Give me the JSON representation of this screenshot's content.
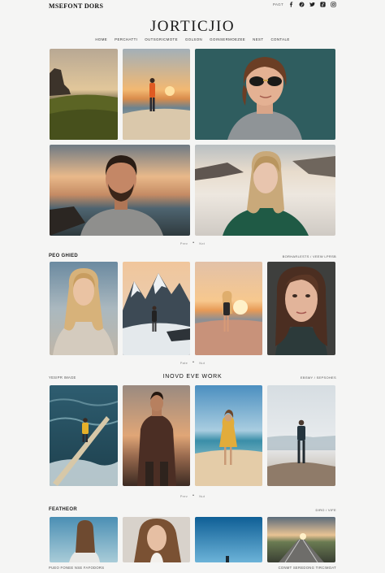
{
  "header": {
    "brand": "MSEFONT DORS",
    "top_link": "PAGT",
    "social_icons": [
      "facebook-icon",
      "pinterest-icon",
      "twitter-icon",
      "tiktok-icon",
      "instagram-icon"
    ]
  },
  "title": "JORTICJIO",
  "nav": [
    "HOME",
    "PERCHATTI",
    "OUTSGRICMOTE",
    "GOLSON",
    "GOINSERMOEZEE",
    "NEST",
    "CONTALE"
  ],
  "pagers": {
    "first": {
      "prev": "Prev",
      "next": "Nxt"
    },
    "second": {
      "prev": "Pate",
      "next": "Nut"
    },
    "third": {
      "prev": "Prev",
      "next": "Nut"
    }
  },
  "sections": {
    "s1": {
      "left": "PEO GHIED",
      "right": "BORHARLESTS / VEEW LPRSB"
    },
    "s2": {
      "left": "YESIPR IMAGE",
      "center": "INOVD EVE WORK",
      "right": "EBSMY / SEPSOHES"
    },
    "s3": {
      "left": "FEATHEOR",
      "right": "DIRO / VIFE"
    }
  },
  "footer": {
    "left": "PUEO FONEE  NSE FAFODORS",
    "right": "CONMT SEREDONG  TIRCIMOAT"
  },
  "colors": {
    "background": "#f5f5f4",
    "text": "#222222"
  }
}
